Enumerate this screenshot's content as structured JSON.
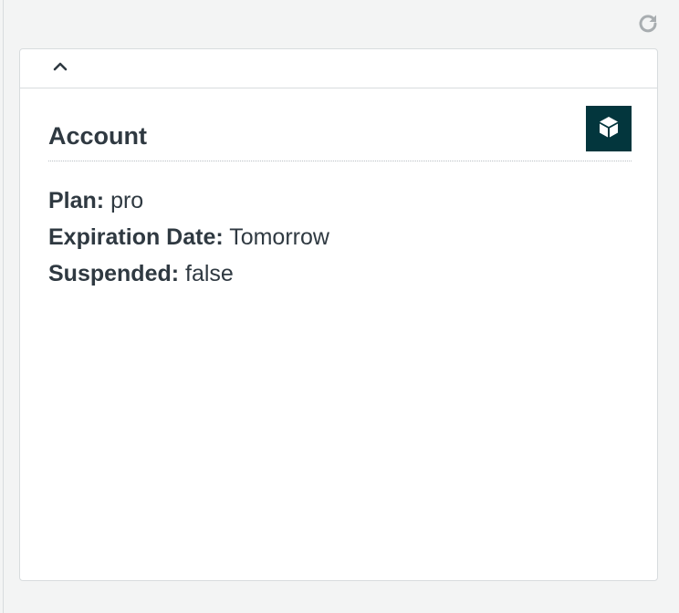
{
  "icons": {
    "refresh": "refresh-icon",
    "collapse": "chevron-up-icon",
    "app": "cube-icon"
  },
  "colors": {
    "background": "#f3f4f4",
    "panel": "#ffffff",
    "badge": "#03363d",
    "text": "#2f3941",
    "border": "#d8dcde",
    "refresh_icon": "#a8adb0"
  },
  "account": {
    "title": "Account",
    "fields": [
      {
        "label": "Plan:",
        "value": "pro"
      },
      {
        "label": "Expiration Date:",
        "value": "Tomorrow"
      },
      {
        "label": "Suspended:",
        "value": "false"
      }
    ]
  }
}
